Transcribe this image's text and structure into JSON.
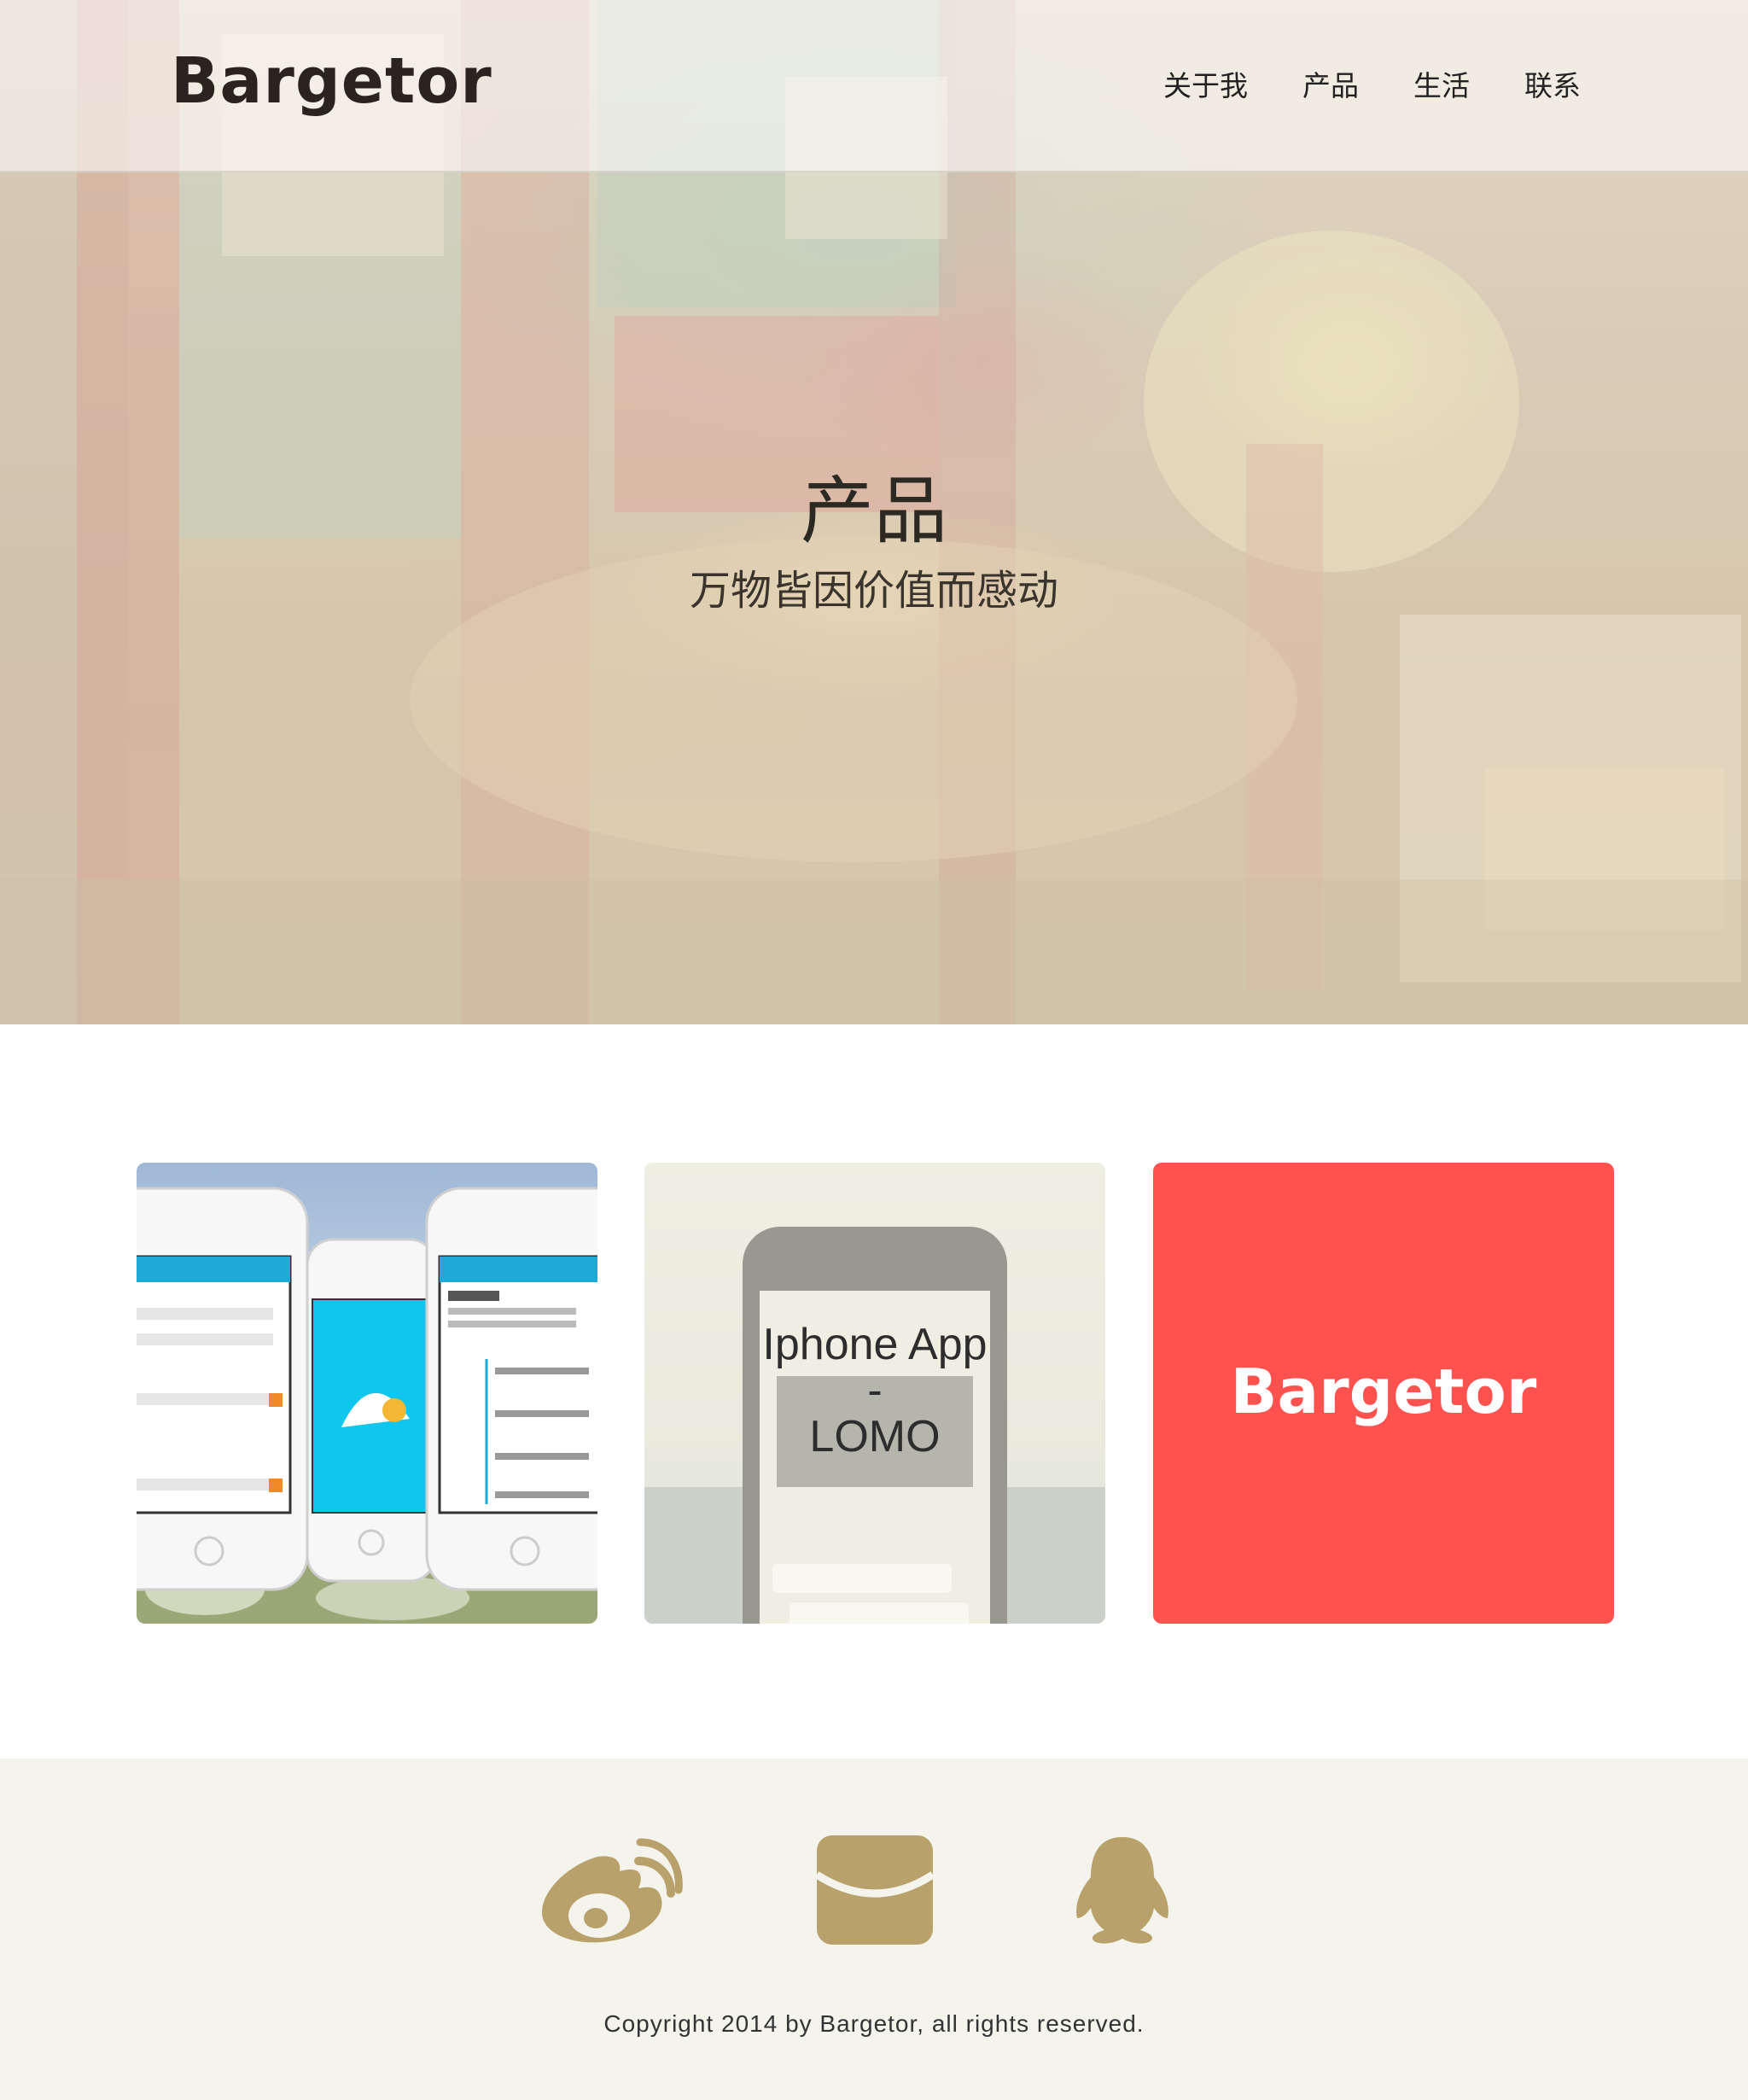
{
  "brand": {
    "logo": "Bargetor"
  },
  "nav": {
    "items": [
      {
        "label": "关于我"
      },
      {
        "label": "产品"
      },
      {
        "label": "生活"
      },
      {
        "label": "联系"
      }
    ]
  },
  "hero": {
    "title": "产品",
    "subtitle": "万物皆因价值而感动"
  },
  "products": [
    {
      "image": "phone-app-screenshots"
    },
    {
      "caption_line1": "Iphone App",
      "caption_line2": "-",
      "caption_line3": "LOMO"
    },
    {
      "logo": "Bargetor",
      "color": "#ff524e"
    }
  ],
  "footer": {
    "social": [
      {
        "icon": "weibo-icon"
      },
      {
        "icon": "mail-icon"
      },
      {
        "icon": "qq-icon"
      }
    ],
    "icon_color": "#b9a16c",
    "copyright": "Copyright 2014 by Bargetor, all rights reserved."
  }
}
